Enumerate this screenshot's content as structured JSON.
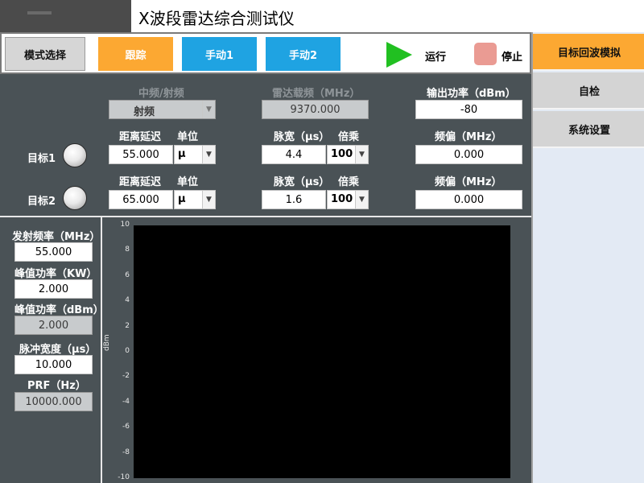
{
  "window": {
    "title": "X波段雷达综合测试仪"
  },
  "toolbar": {
    "mode_select": "模式选择",
    "tabs": [
      "跟踪",
      "手动1",
      "手动2"
    ],
    "run_label": "运行",
    "stop_label": "停止"
  },
  "nav": {
    "items": [
      "目标回波模拟",
      "自检",
      "系统设置"
    ]
  },
  "params": {
    "if_rf_label": "中频/射频",
    "if_rf_value": "射频",
    "carrier_label": "雷达载频（MHz）",
    "carrier_value": "9370.000",
    "output_power_label": "输出功率（dBm）",
    "output_power_value": "-80"
  },
  "targets": [
    {
      "label": "目标1",
      "range_delay_label": "距离延迟",
      "range_delay_value": "55.000",
      "unit_label": "单位",
      "unit_value": "μ",
      "pulse_width_label": "脉宽（μs）",
      "pulse_width_value": "4.4",
      "multiplier_label": "倍乘",
      "multiplier_value": "100",
      "freq_offset_label": "频偏（MHz）",
      "freq_offset_value": "0.000"
    },
    {
      "label": "目标2",
      "range_delay_label": "距离延迟",
      "range_delay_value": "65.000",
      "unit_label": "单位",
      "unit_value": "μ",
      "pulse_width_label": "脉宽（μs）",
      "pulse_width_value": "1.6",
      "multiplier_label": "倍乘",
      "multiplier_value": "100",
      "freq_offset_label": "频偏（MHz）",
      "freq_offset_value": "0.000"
    }
  ],
  "measurements": {
    "tx_freq_label": "发射频率（MHz）",
    "tx_freq_value": "55.000",
    "peak_kw_label": "峰值功率（KW）",
    "peak_kw_value": "2.000",
    "peak_dbm_label": "峰值功率（dBm）",
    "peak_dbm_value": "2.000",
    "pulse_width_label": "脉冲宽度（μs）",
    "pulse_width_value": "10.000",
    "prf_label": "PRF（Hz）",
    "prf_value": "10000.000"
  },
  "colors": {
    "accent_orange": "#fca832",
    "accent_blue": "#1fa3e2",
    "run_green": "#21c021",
    "stop_red": "#ea9b93",
    "panel_bg": "#4a5256"
  },
  "chart_data": {
    "type": "line",
    "title": "",
    "xlabel": "",
    "ylabel": "dBm",
    "ylim": [
      -10,
      10
    ],
    "yticks": [
      "10",
      "8",
      "6",
      "4",
      "2",
      "0",
      "-2",
      "-4",
      "-6",
      "-8",
      "-10"
    ],
    "series": [],
    "grid": false
  }
}
